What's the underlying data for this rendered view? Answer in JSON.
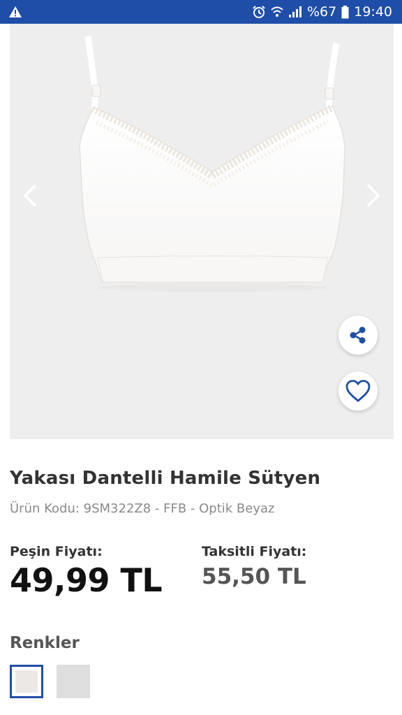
{
  "status_bar": {
    "battery_percent": "%67",
    "time": "19:40",
    "icons": [
      "warning-icon",
      "alarm-icon",
      "wifi-icon",
      "signal-icon",
      "battery-icon"
    ]
  },
  "gallery": {
    "image": "product-photo-white-lace-nursing-bra",
    "icons": [
      "chevron-left-icon",
      "chevron-right-icon",
      "share-icon",
      "heart-icon"
    ]
  },
  "product": {
    "title": "Yakası Dantelli Hamile Sütyen",
    "code_line": "Ürün Kodu: 9SM322Z8 - FFB - Optik Beyaz"
  },
  "pricing": {
    "cash_label": "Peşin Fiyatı:",
    "cash_price": "49,99 TL",
    "installment_label": "Taksitli Fiyatı:",
    "installment_price": "55,50 TL"
  },
  "colors": {
    "title": "Renkler",
    "swatches": [
      {
        "color": "#ece8e6",
        "selected": true
      },
      {
        "color": "#dedede",
        "selected": false
      }
    ]
  },
  "theme": {
    "accent": "#1f4ea8",
    "status_bar": "#1f4ea8"
  }
}
